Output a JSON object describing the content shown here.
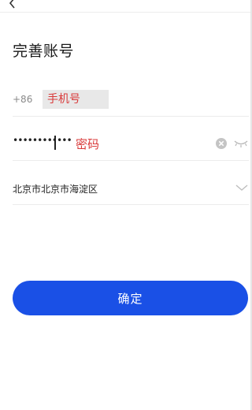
{
  "header": {
    "back_icon": "chevron-left-icon"
  },
  "page": {
    "title": "完善账号"
  },
  "phone": {
    "country_code": "+86",
    "placeholder": "手机号"
  },
  "password": {
    "masked_value": "••••••••••••",
    "placeholder": "密码",
    "clear_icon": "clear-circle-icon",
    "visibility_icon": "eye-closed-icon"
  },
  "region": {
    "value": "北京市北京市海淀区",
    "dropdown_icon": "chevron-down-icon"
  },
  "actions": {
    "confirm_label": "确定"
  },
  "colors": {
    "accent": "#1a50e6",
    "placeholder_red": "#d93a3a",
    "divider": "#ececec"
  }
}
